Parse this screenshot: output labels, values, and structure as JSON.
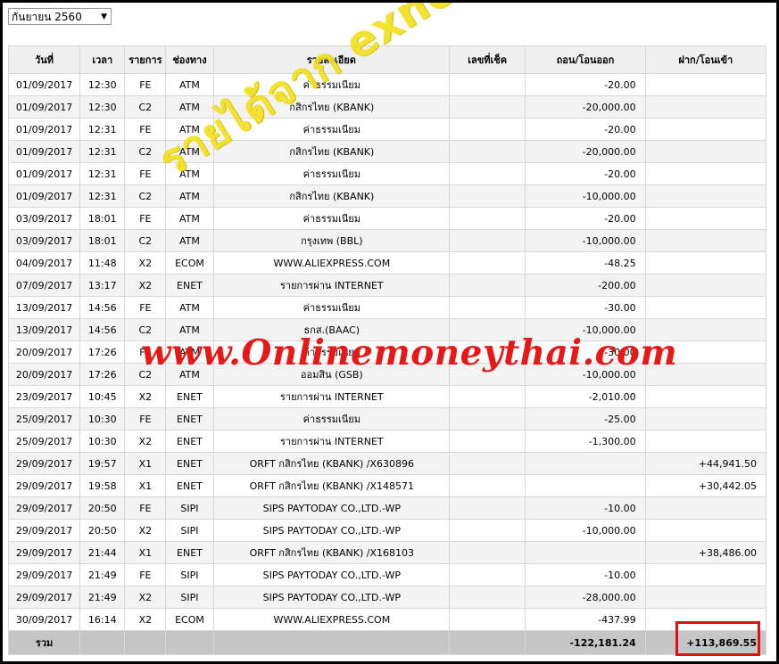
{
  "month_select": {
    "value": "กันยายน 2560"
  },
  "table": {
    "headers": [
      "วันที่",
      "เวลา",
      "รายการ",
      "ช่องทาง",
      "รายละเอียด",
      "เลขที่เช็ค",
      "ถอน/โอนออก",
      "ฝาก/โอนเข้า"
    ],
    "rows": [
      {
        "date": "01/09/2017",
        "time": "12:30",
        "type": "FE",
        "channel": "ATM",
        "detail": "ค่าธรรมเนียม",
        "cheque": "",
        "withdraw": "-20.00",
        "deposit": ""
      },
      {
        "date": "01/09/2017",
        "time": "12:30",
        "type": "C2",
        "channel": "ATM",
        "detail": "กสิกรไทย (KBANK)",
        "cheque": "",
        "withdraw": "-20,000.00",
        "deposit": ""
      },
      {
        "date": "01/09/2017",
        "time": "12:31",
        "type": "FE",
        "channel": "ATM",
        "detail": "ค่าธรรมเนียม",
        "cheque": "",
        "withdraw": "-20.00",
        "deposit": ""
      },
      {
        "date": "01/09/2017",
        "time": "12:31",
        "type": "C2",
        "channel": "ATM",
        "detail": "กสิกรไทย (KBANK)",
        "cheque": "",
        "withdraw": "-20,000.00",
        "deposit": ""
      },
      {
        "date": "01/09/2017",
        "time": "12:31",
        "type": "FE",
        "channel": "ATM",
        "detail": "ค่าธรรมเนียม",
        "cheque": "",
        "withdraw": "-20.00",
        "deposit": ""
      },
      {
        "date": "01/09/2017",
        "time": "12:31",
        "type": "C2",
        "channel": "ATM",
        "detail": "กสิกรไทย (KBANK)",
        "cheque": "",
        "withdraw": "-10,000.00",
        "deposit": ""
      },
      {
        "date": "03/09/2017",
        "time": "18:01",
        "type": "FE",
        "channel": "ATM",
        "detail": "ค่าธรรมเนียม",
        "cheque": "",
        "withdraw": "-20.00",
        "deposit": ""
      },
      {
        "date": "03/09/2017",
        "time": "18:01",
        "type": "C2",
        "channel": "ATM",
        "detail": "กรุงเทพ (BBL)",
        "cheque": "",
        "withdraw": "-10,000.00",
        "deposit": ""
      },
      {
        "date": "04/09/2017",
        "time": "11:48",
        "type": "X2",
        "channel": "ECOM",
        "detail": "WWW.ALIEXPRESS.COM",
        "cheque": "",
        "withdraw": "-48.25",
        "deposit": ""
      },
      {
        "date": "07/09/2017",
        "time": "13:17",
        "type": "X2",
        "channel": "ENET",
        "detail": "รายการผ่าน INTERNET",
        "cheque": "",
        "withdraw": "-200.00",
        "deposit": ""
      },
      {
        "date": "13/09/2017",
        "time": "14:56",
        "type": "FE",
        "channel": "ATM",
        "detail": "ค่าธรรมเนียม",
        "cheque": "",
        "withdraw": "-30.00",
        "deposit": ""
      },
      {
        "date": "13/09/2017",
        "time": "14:56",
        "type": "C2",
        "channel": "ATM",
        "detail": "ธกส.(BAAC)",
        "cheque": "",
        "withdraw": "-10,000.00",
        "deposit": ""
      },
      {
        "date": "20/09/2017",
        "time": "17:26",
        "type": "FE",
        "channel": "ATM",
        "detail": "ค่าธรรมเนียม",
        "cheque": "",
        "withdraw": "-30.00",
        "deposit": ""
      },
      {
        "date": "20/09/2017",
        "time": "17:26",
        "type": "C2",
        "channel": "ATM",
        "detail": "ออมสิน (GSB)",
        "cheque": "",
        "withdraw": "-10,000.00",
        "deposit": ""
      },
      {
        "date": "23/09/2017",
        "time": "10:45",
        "type": "X2",
        "channel": "ENET",
        "detail": "รายการผ่าน INTERNET",
        "cheque": "",
        "withdraw": "-2,010.00",
        "deposit": ""
      },
      {
        "date": "25/09/2017",
        "time": "10:30",
        "type": "FE",
        "channel": "ENET",
        "detail": "ค่าธรรมเนียม",
        "cheque": "",
        "withdraw": "-25.00",
        "deposit": ""
      },
      {
        "date": "25/09/2017",
        "time": "10:30",
        "type": "X2",
        "channel": "ENET",
        "detail": "รายการผ่าน INTERNET",
        "cheque": "",
        "withdraw": "-1,300.00",
        "deposit": ""
      },
      {
        "date": "29/09/2017",
        "time": "19:57",
        "type": "X1",
        "channel": "ENET",
        "detail": "ORFT กสิกรไทย (KBANK) /X630896",
        "cheque": "",
        "withdraw": "",
        "deposit": "+44,941.50"
      },
      {
        "date": "29/09/2017",
        "time": "19:58",
        "type": "X1",
        "channel": "ENET",
        "detail": "ORFT กสิกรไทย (KBANK) /X148571",
        "cheque": "",
        "withdraw": "",
        "deposit": "+30,442.05"
      },
      {
        "date": "29/09/2017",
        "time": "20:50",
        "type": "FE",
        "channel": "SIPI",
        "detail": "SIPS PAYTODAY CO.,LTD.-WP",
        "cheque": "",
        "withdraw": "-10.00",
        "deposit": ""
      },
      {
        "date": "29/09/2017",
        "time": "20:50",
        "type": "X2",
        "channel": "SIPI",
        "detail": "SIPS PAYTODAY CO.,LTD.-WP",
        "cheque": "",
        "withdraw": "-10,000.00",
        "deposit": ""
      },
      {
        "date": "29/09/2017",
        "time": "21:44",
        "type": "X1",
        "channel": "ENET",
        "detail": "ORFT กสิกรไทย (KBANK) /X168103",
        "cheque": "",
        "withdraw": "",
        "deposit": "+38,486.00"
      },
      {
        "date": "29/09/2017",
        "time": "21:49",
        "type": "FE",
        "channel": "SIPI",
        "detail": "SIPS PAYTODAY CO.,LTD.-WP",
        "cheque": "",
        "withdraw": "-10.00",
        "deposit": ""
      },
      {
        "date": "29/09/2017",
        "time": "21:49",
        "type": "X2",
        "channel": "SIPI",
        "detail": "SIPS PAYTODAY CO.,LTD.-WP",
        "cheque": "",
        "withdraw": "-28,000.00",
        "deposit": ""
      },
      {
        "date": "30/09/2017",
        "time": "16:14",
        "type": "X2",
        "channel": "ECOM",
        "detail": "WWW.ALIEXPRESS.COM",
        "cheque": "",
        "withdraw": "-437.99",
        "deposit": ""
      }
    ],
    "footer": {
      "label": "รวม",
      "total_withdraw": "-122,181.24",
      "total_deposit": "+113,869.55"
    }
  },
  "watermarks": {
    "thai": "รายได้จาก exness",
    "site": "www.Onlinemoneythai.com"
  },
  "colors": {
    "highlight_border": "#e01010",
    "watermark_yellow": "#f2e01e",
    "watermark_red": "#e81818"
  }
}
